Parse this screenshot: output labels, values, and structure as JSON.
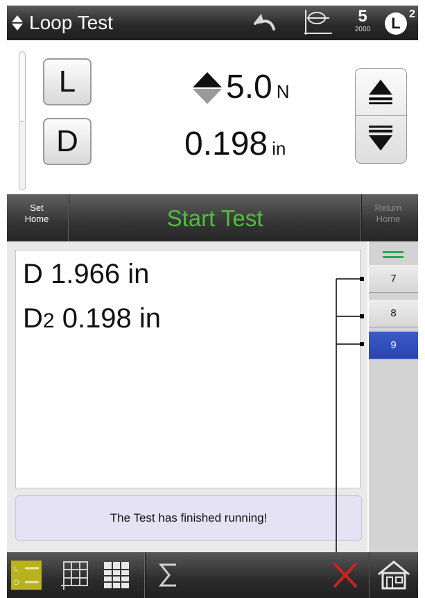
{
  "header": {
    "title": "Loop Test",
    "rate_value": "5",
    "rate_unit": "2000",
    "load_cell_label": "L",
    "load_cell_sup": "2",
    "icons": [
      "menu-arrows-icon",
      "undo-icon",
      "graph-icon",
      "rate-icon",
      "load-cell-icon"
    ]
  },
  "readout": {
    "load_button": "L",
    "distance_button": "D",
    "load_value": "5.0",
    "load_unit": "N",
    "distance_value": "0.198",
    "distance_unit": "in"
  },
  "actions": {
    "set_home": [
      "Set",
      "Home"
    ],
    "start_test": "Start Test",
    "return_home": [
      "Return",
      "Home"
    ]
  },
  "results": {
    "d_label": "D",
    "d_value": "1.966 in",
    "d2_label": "D",
    "d2_sub": "2",
    "d2_value": "0.198 in"
  },
  "status": {
    "message": "The Test has finished running!"
  },
  "side_list": {
    "items": [
      "7",
      "8",
      "9"
    ],
    "active": "9"
  },
  "colors": {
    "start_test_green": "#4fbf3a",
    "active_item_blue": "#2e4bbb",
    "status_bg": "#e4e2f3",
    "cancel_red": "#cc2222",
    "graph_view_highlight": "#b8b21e"
  },
  "bottom_toolbar": {
    "icons": [
      "graph-view-icon",
      "grid-view-icon",
      "table-view-icon",
      "statistics-sigma-icon",
      "cancel-x-icon",
      "home-icon"
    ]
  }
}
